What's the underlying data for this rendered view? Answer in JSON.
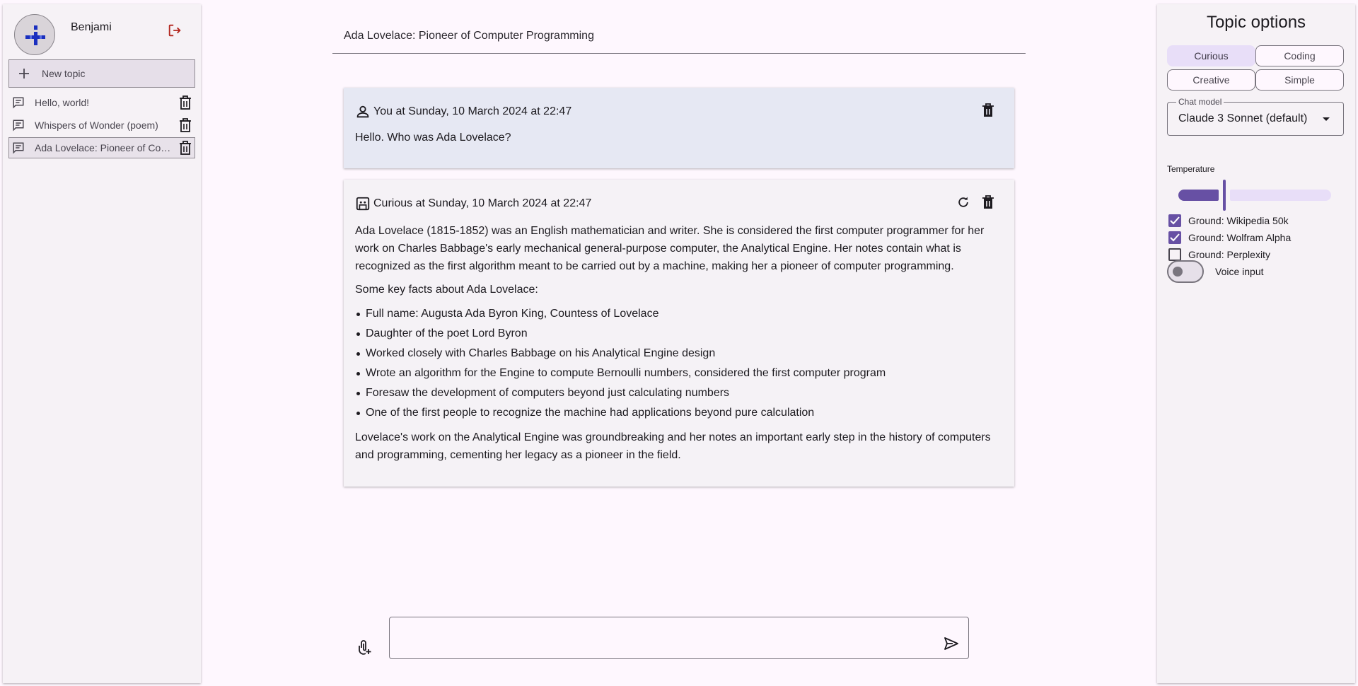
{
  "user": {
    "name": "Benjami"
  },
  "sidebar": {
    "new_topic_label": "New topic",
    "topics": [
      {
        "label": "Hello, world!"
      },
      {
        "label": "Whispers of Wonder (poem)"
      },
      {
        "label": "Ada Lovelace: Pioneer of Computer Programming"
      }
    ],
    "active_index": 2
  },
  "main": {
    "title": "Ada Lovelace: Pioneer of Computer Programming",
    "messages": [
      {
        "role": "user",
        "header": "You at Sunday, 10 March 2024 at 22:47",
        "text": "Hello. Who was Ada Lovelace?"
      },
      {
        "role": "assistant",
        "header": "Curious at Sunday, 10 March 2024 at 22:47",
        "paragraph_1": "Ada Lovelace (1815-1852) was an English mathematician and writer. She is considered the first computer programmer for her work on Charles Babbage's early mechanical general-purpose computer, the Analytical Engine. Her notes contain what is recognized as the first algorithm meant to be carried out by a machine, making her a pioneer of computer programming.",
        "paragraph_2": "Some key facts about Ada Lovelace:",
        "bullets": [
          "Full name: Augusta Ada Byron King, Countess of Lovelace",
          "Daughter of the poet Lord Byron",
          "Worked closely with Charles Babbage on his Analytical Engine design",
          "Wrote an algorithm for the Engine to compute Bernoulli numbers, considered the first computer program",
          "Foresaw the development of computers beyond just calculating numbers",
          "One of the first people to recognize the machine had applications beyond pure calculation"
        ],
        "paragraph_3": "Lovelace's work on the Analytical Engine was groundbreaking and her notes an important early step in the history of computers and programming, cementing her legacy as a pioneer in the field."
      }
    ],
    "composer": {
      "value": "",
      "placeholder": ""
    }
  },
  "options": {
    "title": "Topic options",
    "personas": [
      {
        "label": "Curious",
        "selected": true
      },
      {
        "label": "Coding",
        "selected": false
      },
      {
        "label": "Creative",
        "selected": false
      },
      {
        "label": "Simple",
        "selected": false
      }
    ],
    "model_label": "Chat model",
    "model_value": "Claude 3 Sonnet (default)",
    "temperature_label": "Temperature",
    "temperature_fraction": 0.3,
    "grounding": [
      {
        "label": "Ground: Wikipedia 50k",
        "checked": true
      },
      {
        "label": "Ground: Wolfram Alpha",
        "checked": true
      },
      {
        "label": "Ground: Perplexity",
        "checked": false
      }
    ],
    "voice_input_label": "Voice input",
    "voice_input_on": false
  },
  "colors": {
    "accent": "#6750a4",
    "accent_container": "#e8def8",
    "logout": "#b3261e",
    "avatar_glyph": "#1a2fbf"
  }
}
